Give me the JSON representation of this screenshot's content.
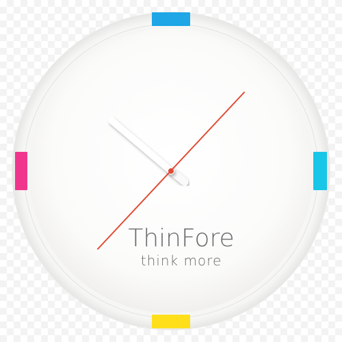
{
  "brand": {
    "name": "ThinFore",
    "tagline": "think more"
  },
  "colors": {
    "marker_top": "#1ea6e6",
    "marker_right": "#18c6e8",
    "marker_bottom": "#ffdf19",
    "marker_left": "#f0368c",
    "second_hand": "#e04a32",
    "text": "#6b6b6b"
  },
  "clock": {
    "icon": "wall-clock-icon",
    "hands": [
      "hour-hand",
      "minute-hand",
      "second-hand"
    ]
  }
}
